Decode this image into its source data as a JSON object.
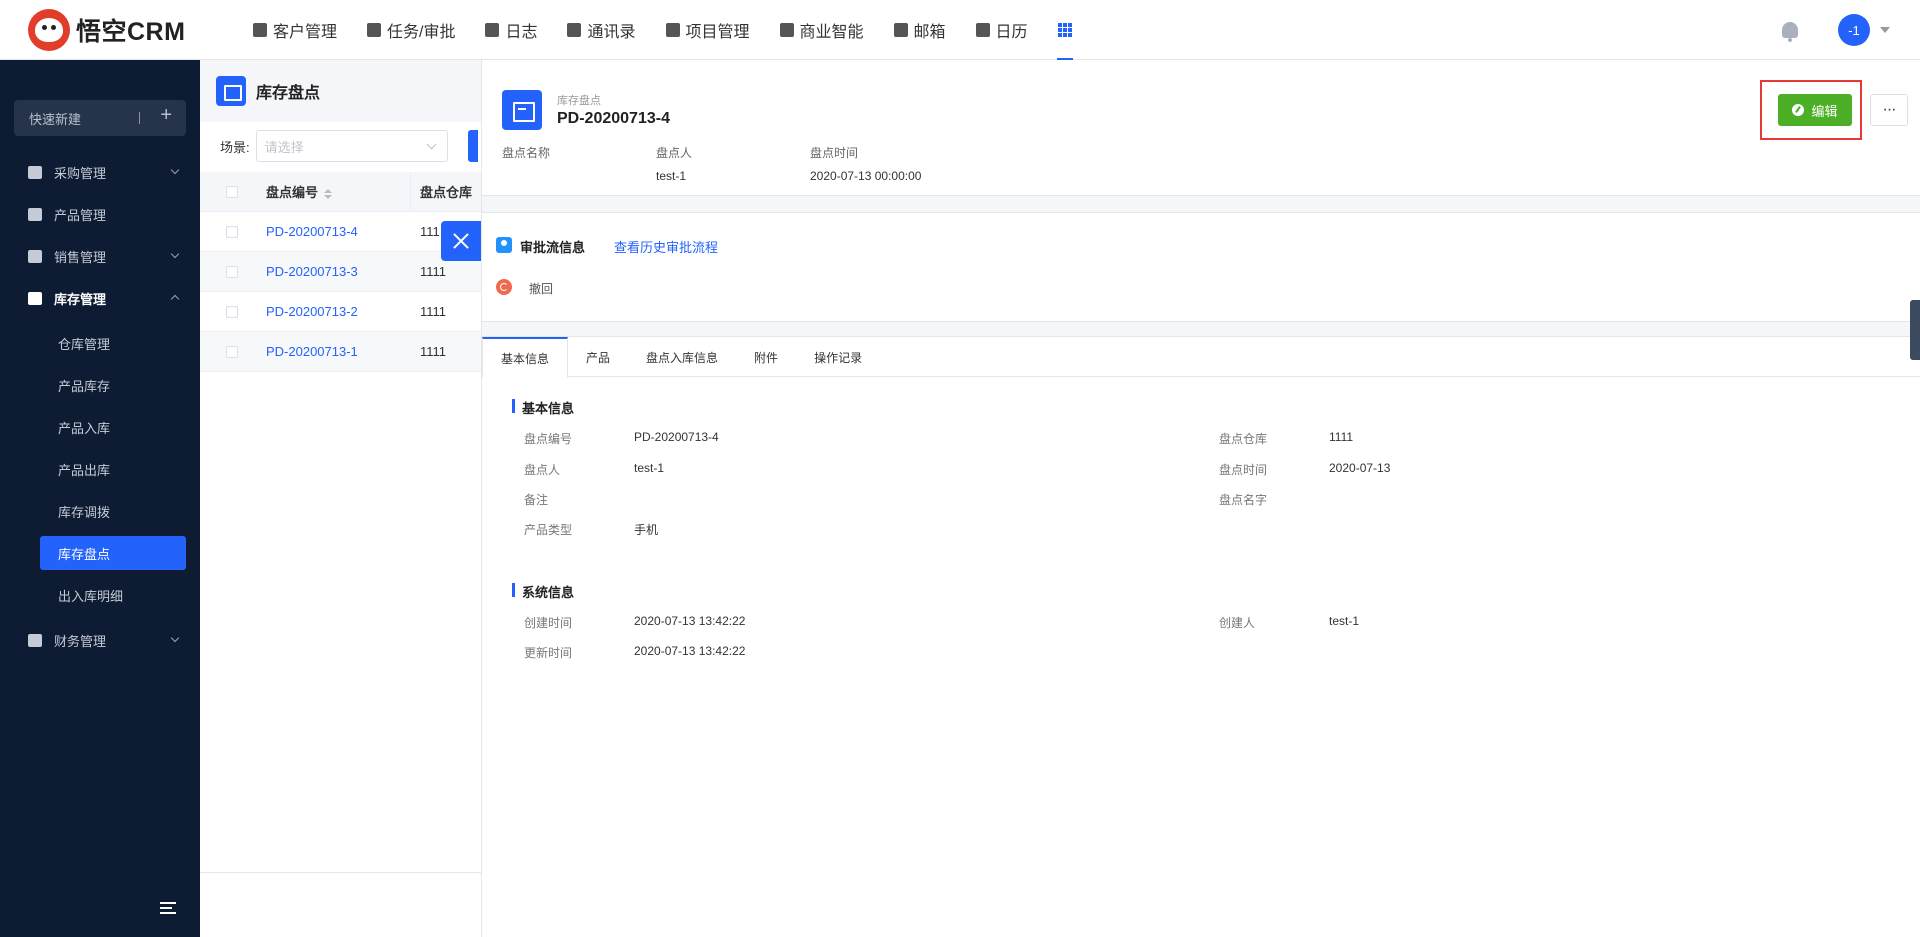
{
  "app": {
    "logo_text": "悟空CRM"
  },
  "topnav": {
    "items": [
      {
        "label": "客户管理",
        "icon": "customer-icon"
      },
      {
        "label": "任务/审批",
        "icon": "briefcase-icon"
      },
      {
        "label": "日志",
        "icon": "log-icon"
      },
      {
        "label": "通讯录",
        "icon": "contacts-icon"
      },
      {
        "label": "项目管理",
        "icon": "project-icon"
      },
      {
        "label": "商业智能",
        "icon": "bi-icon"
      },
      {
        "label": "邮箱",
        "icon": "mail-icon"
      },
      {
        "label": "日历",
        "icon": "calendar-icon"
      }
    ],
    "apps_icon": "grid-icon",
    "avatar_text": "-1"
  },
  "sidebar": {
    "quick_create": "快速新建",
    "menu": [
      {
        "label": "采购管理"
      },
      {
        "label": "产品管理"
      },
      {
        "label": "销售管理"
      },
      {
        "label": "库存管理"
      },
      {
        "label": "财务管理"
      }
    ],
    "sub_items": [
      "仓库管理",
      "产品库存",
      "产品入库",
      "产品出库",
      "库存调拨",
      "库存盘点",
      "出入库明细"
    ],
    "active_sub": "库存盘点"
  },
  "list": {
    "title": "库存盘点",
    "filter_label": "场景:",
    "filter_placeholder": "请选择",
    "columns": [
      "盘点编号",
      "盘点仓库"
    ],
    "rows": [
      {
        "code": "PD-20200713-4",
        "warehouse": "111"
      },
      {
        "code": "PD-20200713-3",
        "warehouse": "1111"
      },
      {
        "code": "PD-20200713-2",
        "warehouse": "1111"
      },
      {
        "code": "PD-20200713-1",
        "warehouse": "1111"
      }
    ]
  },
  "detail": {
    "subtitle": "库存盘点",
    "title": "PD-20200713-4",
    "meta": [
      {
        "label": "盘点名称",
        "value": ""
      },
      {
        "label": "盘点人",
        "value": "test-1"
      },
      {
        "label": "盘点时间",
        "value": "2020-07-13 00:00:00"
      }
    ],
    "edit_label": "编辑",
    "more_label": "···",
    "approval": {
      "title": "审批流信息",
      "history_link": "查看历史审批流程",
      "revoke": "撤回"
    },
    "tabs": [
      "基本信息",
      "产品",
      "盘点入库信息",
      "附件",
      "操作记录"
    ],
    "basic": {
      "section_title": "基本信息",
      "fields": [
        {
          "label": "盘点编号",
          "value": "PD-20200713-4"
        },
        {
          "label": "盘点仓库",
          "value": "1111"
        },
        {
          "label": "盘点人",
          "value": "test-1"
        },
        {
          "label": "盘点时间",
          "value": "2020-07-13"
        },
        {
          "label": "备注",
          "value": ""
        },
        {
          "label": "盘点名字",
          "value": ""
        },
        {
          "label": "产品类型",
          "value": "手机"
        }
      ]
    },
    "system": {
      "section_title": "系统信息",
      "fields": [
        {
          "label": "创建时间",
          "value": "2020-07-13 13:42:22"
        },
        {
          "label": "创建人",
          "value": "test-1"
        },
        {
          "label": "更新时间",
          "value": "2020-07-13 13:42:22"
        }
      ]
    }
  },
  "colors": {
    "primary": "#2362fb",
    "sidebar_bg": "#0d1b33",
    "edit_green": "#4caf26",
    "highlight_red": "#e53935"
  }
}
